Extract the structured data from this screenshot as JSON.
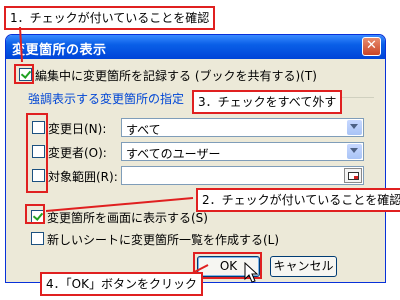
{
  "dialog": {
    "title": "変更箇所の表示",
    "close_glyph": "✕",
    "record_label": "編集中に変更箇所を記録する (ブックを共有する)(T)",
    "group_title": "強調表示する変更箇所の指定",
    "filters": [
      {
        "label": "変更日(N):",
        "value": "すべて",
        "checked": false
      },
      {
        "label": "変更者(O):",
        "value": "すべてのユーザー",
        "checked": false
      },
      {
        "label": "対象範囲(R):",
        "value": "",
        "checked": false
      }
    ],
    "show_on_screen_label": "変更箇所を画面に表示する(S)",
    "new_sheet_label": "新しいシートに変更箇所一覧を作成する(L)",
    "ok_label": "OK",
    "cancel_label": "キャンセル"
  },
  "annotations": {
    "step1": "1．チェックが付いていることを確認",
    "step2": "2．チェックが付いていることを確認",
    "step3": "3．チェックをすべて外す",
    "step4": "4．「OK」ボタンをクリック"
  },
  "colors": {
    "title_bar": "#0a5fe7",
    "dialog_bg": "#ece9d8",
    "annotation_red": "#e02020",
    "group_title": "#0046d5"
  }
}
